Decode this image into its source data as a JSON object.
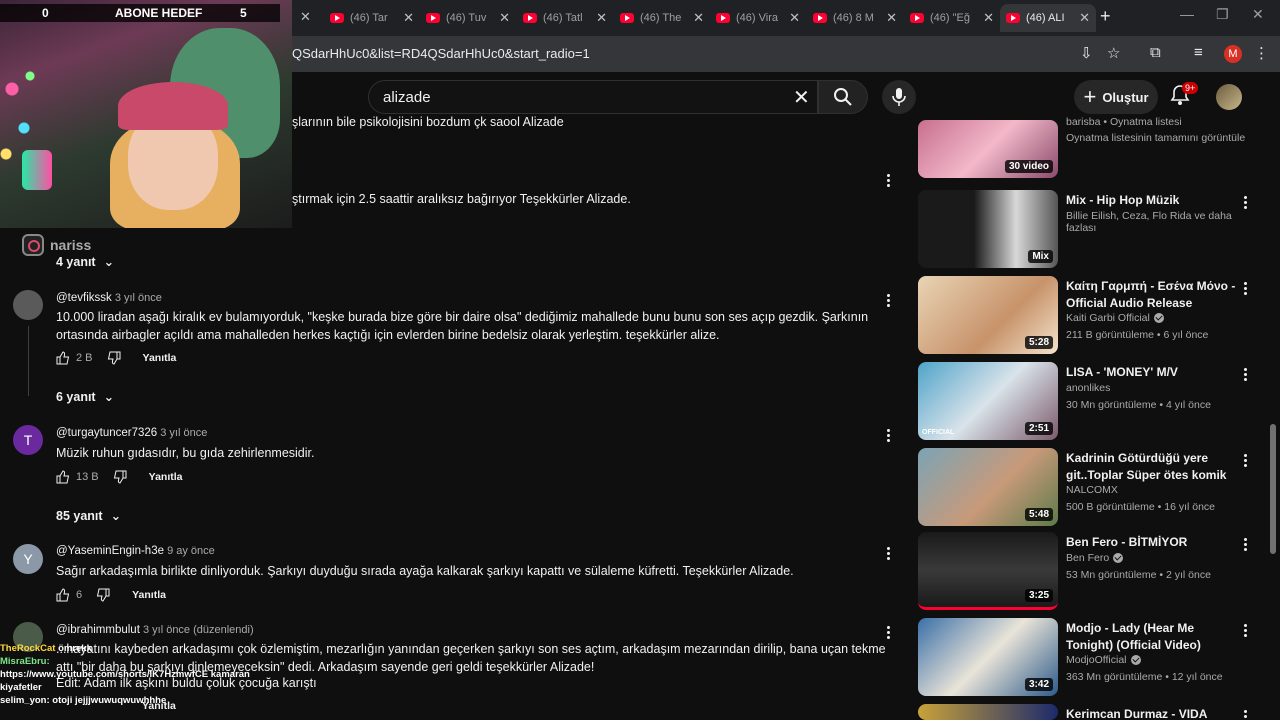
{
  "browser": {
    "tabs": [
      {
        "title": "(46) Tar"
      },
      {
        "title": "(46) Tuv"
      },
      {
        "title": "(46) Tatl"
      },
      {
        "title": "(46) The"
      },
      {
        "title": "(46) Vira"
      },
      {
        "title": "(46) 8 M"
      },
      {
        "title": "(46) \"Eğ"
      },
      {
        "title": "(46) ALI"
      }
    ],
    "url": "QSdarHhUc0&list=RD4QSdarHhUc0&start_radio=1",
    "profile_initial": "M"
  },
  "youtube": {
    "search_value": "alizade",
    "create_label": "Oluştur",
    "notifications_badge": "9+"
  },
  "overlay": {
    "goal_current": "0",
    "goal_label": "ABONE HEDEF",
    "goal_target": "5",
    "instagram_handle": "nariss",
    "chat": [
      {
        "user": "TheRockCat",
        "text": "ömrekk"
      },
      {
        "user": "MisraEbru:",
        "text": ""
      },
      {
        "user": "",
        "text": "https://www.youtube.com/shorts/lK7HzmwfCE kamaran"
      },
      {
        "user": "",
        "text": "kiyafetler"
      },
      {
        "user": "selim_yon:",
        "text": "otoji jejjjwuwuqwuwhhhe"
      }
    ]
  },
  "comments": {
    "partial_1": "şlarının bile psikolojisini bozdum çk saool Alizade",
    "partial_2": "ştırmak için 2.5 saattir aralıksız bağırıyor Teşekkürler Alizade.",
    "replies_1": "4 yanıt",
    "items": [
      {
        "author": "@tevfikssk",
        "time": "3 yıl önce",
        "text": "10.000 liradan aşağı kiralık ev bulamıyorduk, \"keşke burada bize göre bir daire olsa\" dediğimiz mahallede bunu bunu son ses açıp gezdik. Şarkının ortasında airbagler açıldı ama mahalleden herkes kaçtığı için evlerden birine bedelsiz olarak yerleştim. teşekkürler alize.",
        "likes": "2 B",
        "reply_label": "Yanıtla",
        "replies": "6 yanıt"
      },
      {
        "author": "@turgaytuncer7326",
        "time": "3 yıl önce",
        "avatar_letter": "T",
        "text": "Müzik ruhun gıdasıdır, bu gıda zehirlenmesidir.",
        "likes": "13 B",
        "reply_label": "Yanıtla",
        "replies": "85 yanıt"
      },
      {
        "author": "@YaseminEngin-h3e",
        "time": "9 ay önce",
        "avatar_letter": "Y",
        "text": "Sağır arkadaşımla birlikte dinliyorduk. Şarkıyı duyduğu sırada ayağa kalkarak şarkıyı kapattı ve sülaleme küfretti. Teşekkürler Alizade.",
        "likes": "6",
        "reply_label": "Yanıtla"
      },
      {
        "author": "@ibrahimmbulut",
        "time": "3 yıl önce (düzenlendi)",
        "text": "...hayatını kaybeden arkadaşımı çok özlemiştim, mezarlığın yanından geçerken şarkıyı son ses açtım, arkadaşım mezarından dirilip, bana uçan tekme attı \"bir daha bu şarkıyı dinlemeyeceksin\" dedi. Arkadaşım sayende geri geldi teşekkürler Alizade!",
        "edit": "Edit: Adam ilk aşkını buldu çoluk çocuğa karıştı",
        "reply_label": "Yanıtla"
      }
    ]
  },
  "sidebar": {
    "items": [
      {
        "title": "barisba • Oynatma listesi",
        "meta": "Oynatma listesinin tamamını görüntüle",
        "badge": "30 video"
      },
      {
        "title": "Mix - Hip Hop Müzik",
        "meta": "Billie Eilish, Ceza, Flo Rida ve daha fazlası",
        "badge": "Mix"
      },
      {
        "title": "Καίτη Γαρμπή - Εσένα Μόνο - Official Audio Release",
        "channel": "Kaiti Garbi Official",
        "meta": "211 B görüntüleme • 6 yıl önce",
        "duration": "5:28"
      },
      {
        "title": "LISA - 'MONEY' M/V",
        "channel": "anonlikes",
        "meta": "30 Mn görüntüleme • 4 yıl önce",
        "duration": "2:51",
        "thumb_label": "OFFICIAL"
      },
      {
        "title": "Kadrinin Götürdüğü yere git..Toplar Süper ötes komik",
        "channel": "NALCOMX",
        "meta": "500 B görüntüleme • 16 yıl önce",
        "duration": "5:48"
      },
      {
        "title": "Ben Fero - BİTMİYOR",
        "channel": "Ben Fero",
        "meta": "53 Mn görüntüleme • 2 yıl önce",
        "duration": "3:25"
      },
      {
        "title": "Modjo - Lady (Hear Me Tonight) (Official Video)",
        "channel": "ModjoOfficial",
        "meta": "363 Mn görüntüleme • 12 yıl önce",
        "duration": "3:42"
      },
      {
        "title": "Kerimcan Durmaz - VIDA LOCA"
      }
    ]
  }
}
